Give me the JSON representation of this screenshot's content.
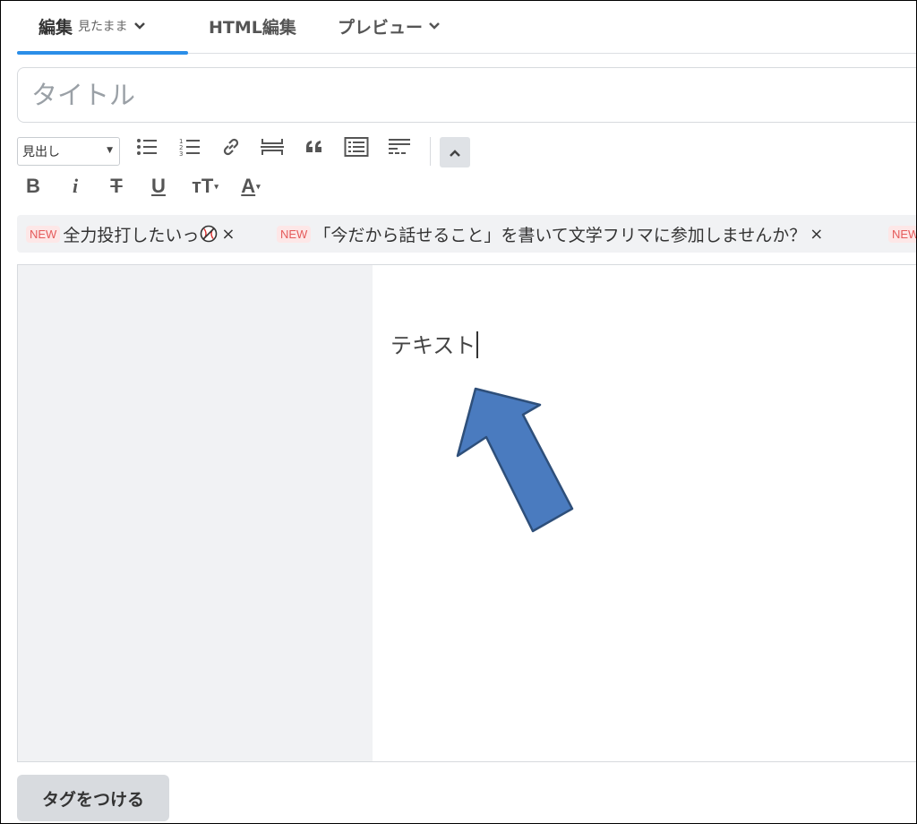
{
  "tabs": [
    {
      "label": "編集",
      "sub": "見たまま",
      "active": true
    },
    {
      "label": "HTML編集"
    },
    {
      "label": "プレビュー"
    }
  ],
  "title": {
    "placeholder": "タイトル",
    "value": ""
  },
  "toolbar": {
    "heading_select": "見出し",
    "buttons_row1": [
      "unordered-list-icon",
      "ordered-list-icon",
      "link-icon",
      "horizontal-rule-icon",
      "quote-icon",
      "table-of-contents-icon",
      "more-icon",
      "collapse-up-icon"
    ],
    "bold": "B",
    "italic": "i",
    "strike": "T",
    "underline": "U",
    "text_size": "тT",
    "font_color": "A"
  },
  "tag_suggestions": [
    {
      "badge": "NEW",
      "text": "全力投打したいっ",
      "close": "×"
    },
    {
      "badge": "NEW",
      "text": "「今だから話せること」を書いて文学フリマに参加しませんか？",
      "close": "×"
    },
    {
      "badge": "NEW",
      "text": ""
    }
  ],
  "editor": {
    "content": "テキスト"
  },
  "colors": {
    "accent": "#2b8ee8",
    "arrow_fill": "#4a7bbf",
    "arrow_stroke": "#2e4f7a",
    "new_badge": "#e55b5b"
  },
  "footer": {
    "tag_button": "タグをつける"
  }
}
